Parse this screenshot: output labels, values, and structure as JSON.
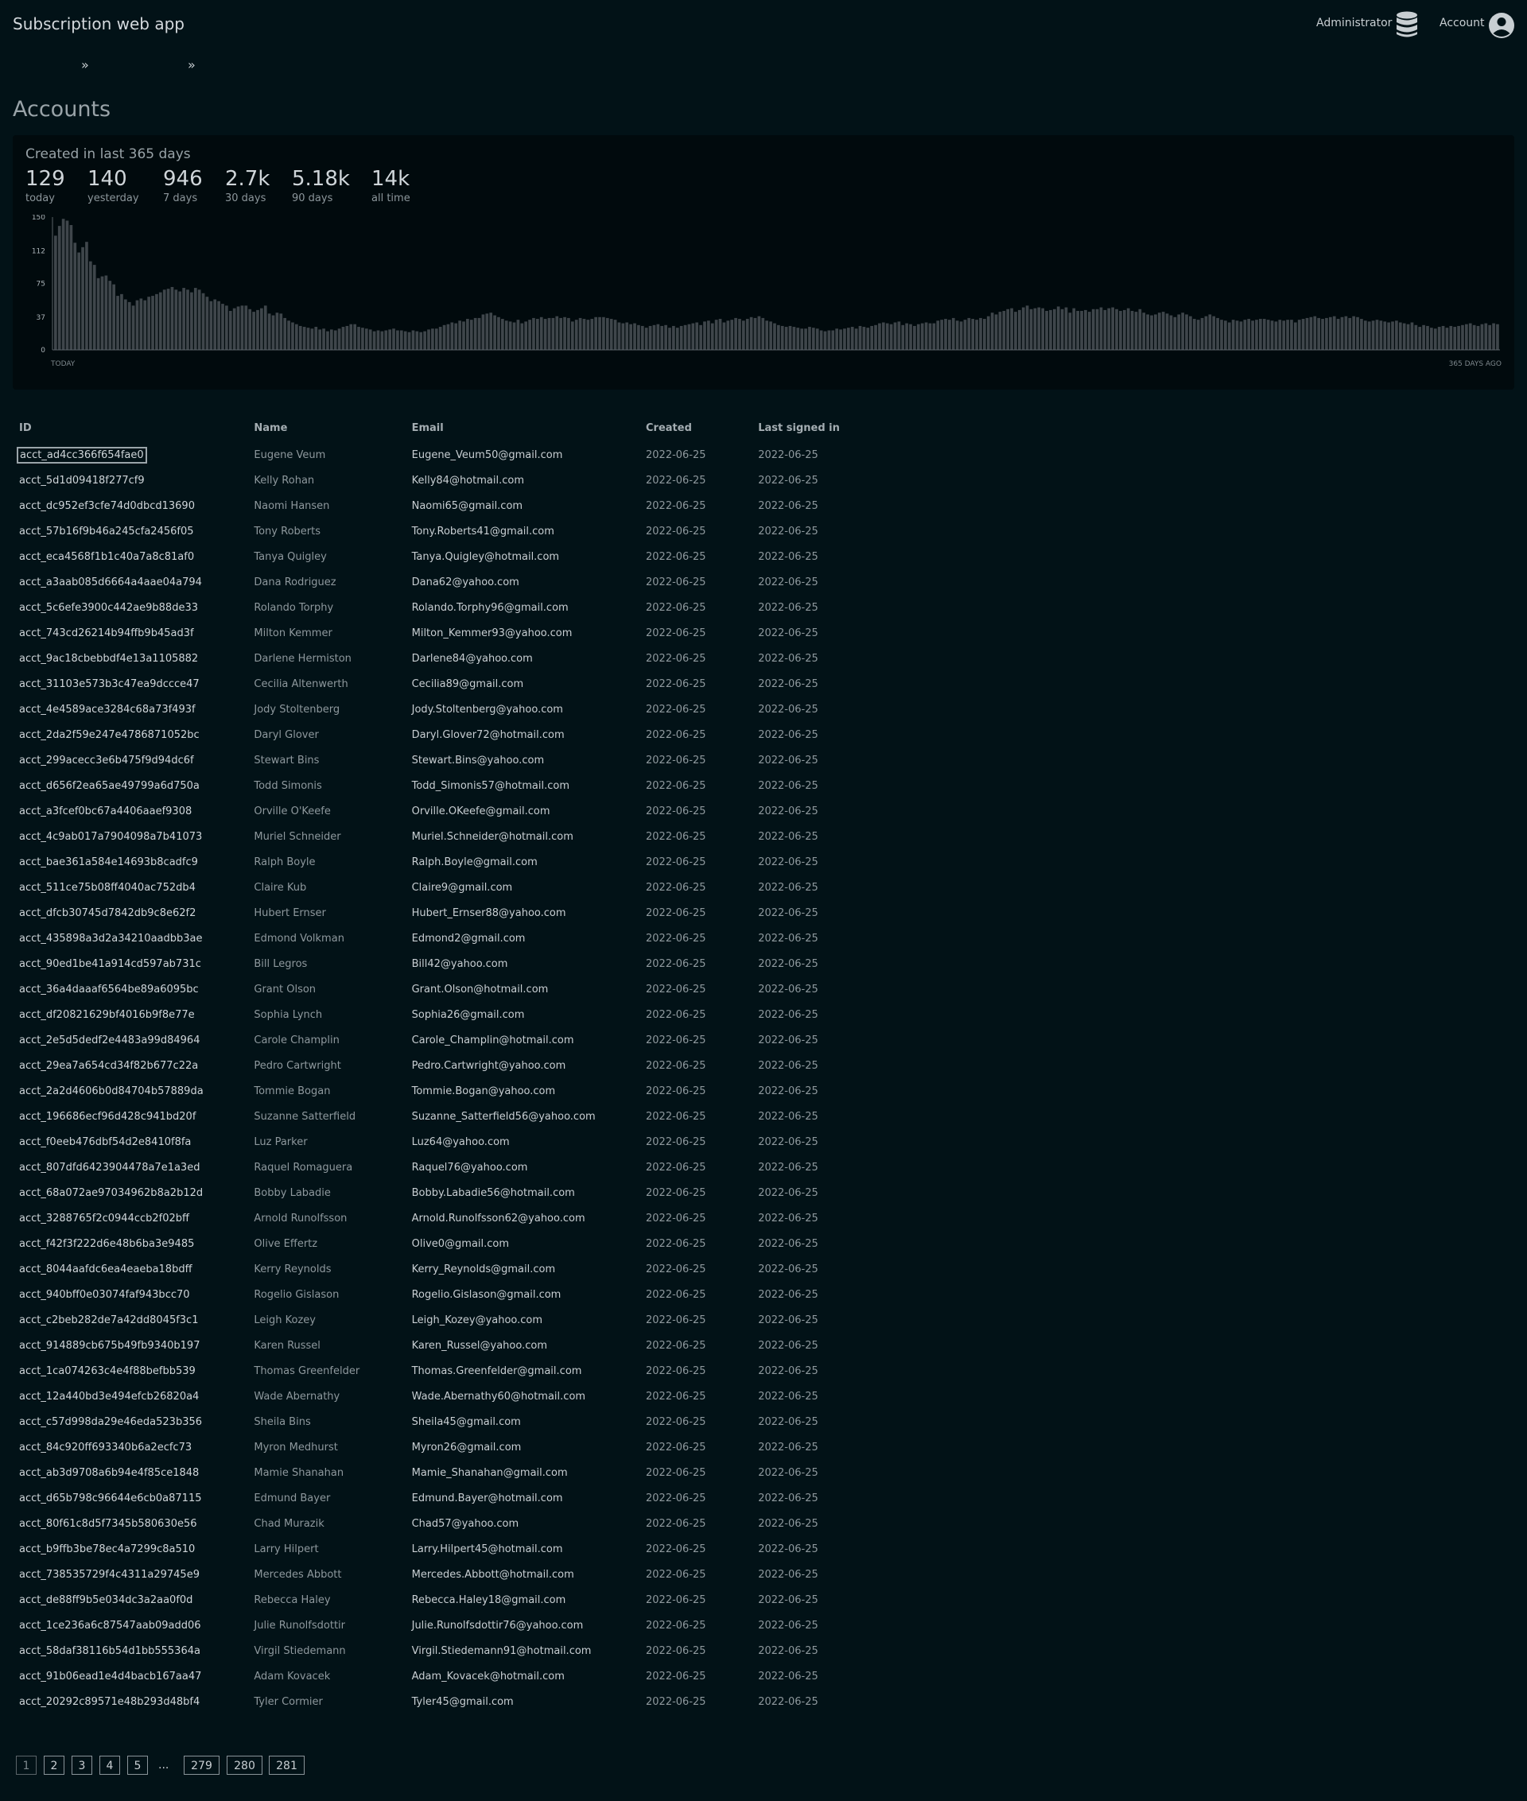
{
  "app": {
    "title": "Subscription web app"
  },
  "header": {
    "admin_label": "Administrator",
    "account_label": "Account",
    "admin_icon": "database-icon",
    "account_icon": "user-circle-icon"
  },
  "breadcrumb": {
    "separators": [
      "»",
      "»"
    ]
  },
  "page": {
    "title": "Accounts"
  },
  "stats": {
    "title": "Created in last 365 days",
    "items": [
      {
        "value": "129",
        "label": "today"
      },
      {
        "value": "140",
        "label": "yesterday"
      },
      {
        "value": "946",
        "label": "7 days"
      },
      {
        "value": "2.7k",
        "label": "30 days"
      },
      {
        "value": "5.18k",
        "label": "90 days"
      },
      {
        "value": "14k",
        "label": "all time"
      }
    ]
  },
  "chart_data": {
    "type": "bar",
    "yticks": [
      0,
      37,
      75,
      112,
      150
    ],
    "ylim": [
      0,
      150
    ],
    "x_start_label": "TODAY",
    "x_end_label": "365 DAYS AGO",
    "colors": {
      "bar": "#3f464b"
    },
    "values": [
      129,
      140,
      148,
      146,
      141,
      121,
      110,
      116,
      122,
      100,
      96,
      81,
      83,
      84,
      78,
      74,
      61,
      63,
      57,
      54,
      50,
      56,
      58,
      56,
      60,
      61,
      63,
      65,
      68,
      69,
      71,
      68,
      66,
      70,
      68,
      65,
      70,
      68,
      64,
      60,
      55,
      57,
      55,
      52,
      50,
      44,
      47,
      49,
      50,
      50,
      46,
      43,
      45,
      47,
      50,
      41,
      39,
      42,
      41,
      36,
      33,
      31,
      29,
      27,
      26,
      25,
      24,
      26,
      23,
      24,
      21,
      23,
      22,
      24,
      26,
      27,
      29,
      29,
      26,
      25,
      24,
      23,
      21,
      22,
      21,
      22,
      23,
      24,
      22,
      22,
      21,
      20,
      22,
      21,
      20,
      21,
      23,
      24,
      24,
      26,
      28,
      29,
      31,
      30,
      33,
      32,
      35,
      34,
      36,
      36,
      40,
      41,
      42,
      39,
      37,
      35,
      33,
      32,
      31,
      34,
      30,
      32,
      34,
      36,
      35,
      37,
      35,
      36,
      36,
      38,
      36,
      37,
      36,
      32,
      34,
      36,
      35,
      34,
      35,
      37,
      37,
      37,
      36,
      35,
      34,
      31,
      30,
      31,
      29,
      30,
      28,
      27,
      25,
      27,
      28,
      29,
      27,
      28,
      25,
      27,
      25,
      27,
      28,
      29,
      30,
      31,
      28,
      32,
      33,
      30,
      34,
      35,
      31,
      33,
      34,
      36,
      35,
      33,
      35,
      37,
      36,
      38,
      36,
      33,
      32,
      30,
      28,
      27,
      26,
      27,
      26,
      25,
      24,
      24,
      26,
      25,
      24,
      22,
      21,
      22,
      22,
      24,
      23,
      24,
      25,
      26,
      24,
      27,
      26,
      25,
      27,
      28,
      30,
      31,
      30,
      29,
      31,
      32,
      28,
      30,
      29,
      27,
      29,
      30,
      31,
      30,
      30,
      33,
      34,
      35,
      34,
      36,
      33,
      32,
      34,
      36,
      35,
      34,
      36,
      35,
      38,
      42,
      40,
      43,
      44,
      46,
      47,
      43,
      45,
      48,
      50,
      46,
      47,
      48,
      47,
      44,
      45,
      46,
      49,
      46,
      48,
      42,
      47,
      44,
      44,
      45,
      43,
      46,
      46,
      48,
      45,
      47,
      48,
      46,
      44,
      45,
      47,
      44,
      43,
      46,
      42,
      40,
      39,
      40,
      42,
      43,
      41,
      39,
      37,
      40,
      42,
      40,
      38,
      35,
      34,
      36,
      38,
      40,
      38,
      36,
      34,
      33,
      31,
      34,
      33,
      32,
      34,
      35,
      33,
      34,
      35,
      35,
      34,
      33,
      32,
      34,
      33,
      34,
      34,
      31,
      34,
      35,
      36,
      37,
      38,
      36,
      35,
      36,
      37,
      38,
      35,
      37,
      38,
      36,
      38,
      37,
      35,
      33,
      32,
      33,
      34,
      33,
      32,
      31,
      32,
      33,
      31,
      30,
      29,
      31,
      28,
      26,
      28,
      27,
      25,
      24,
      26,
      27,
      25,
      27,
      26,
      27,
      28,
      29,
      30,
      28,
      27,
      29,
      30,
      28,
      30,
      29
    ]
  },
  "table": {
    "columns": [
      "ID",
      "Name",
      "Email",
      "Created",
      "Last signed in"
    ],
    "rows": [
      [
        "acct_ad4cc366f654fae0",
        "Eugene Veum",
        "Eugene_Veum50@gmail.com",
        "2022-06-25",
        "2022-06-25"
      ],
      [
        "acct_5d1d09418f277cf9",
        "Kelly Rohan",
        "Kelly84@hotmail.com",
        "2022-06-25",
        "2022-06-25"
      ],
      [
        "acct_dc952ef3cfe74d0dbcd13690",
        "Naomi Hansen",
        "Naomi65@gmail.com",
        "2022-06-25",
        "2022-06-25"
      ],
      [
        "acct_57b16f9b46a245cfa2456f05",
        "Tony Roberts",
        "Tony.Roberts41@gmail.com",
        "2022-06-25",
        "2022-06-25"
      ],
      [
        "acct_eca4568f1b1c40a7a8c81af0",
        "Tanya Quigley",
        "Tanya.Quigley@hotmail.com",
        "2022-06-25",
        "2022-06-25"
      ],
      [
        "acct_a3aab085d6664a4aae04a794",
        "Dana Rodriguez",
        "Dana62@yahoo.com",
        "2022-06-25",
        "2022-06-25"
      ],
      [
        "acct_5c6efe3900c442ae9b88de33",
        "Rolando Torphy",
        "Rolando.Torphy96@gmail.com",
        "2022-06-25",
        "2022-06-25"
      ],
      [
        "acct_743cd26214b94ffb9b45ad3f",
        "Milton Kemmer",
        "Milton_Kemmer93@yahoo.com",
        "2022-06-25",
        "2022-06-25"
      ],
      [
        "acct_9ac18cbebbdf4e13a1105882",
        "Darlene Hermiston",
        "Darlene84@yahoo.com",
        "2022-06-25",
        "2022-06-25"
      ],
      [
        "acct_31103e573b3c47ea9dccce47",
        "Cecilia Altenwerth",
        "Cecilia89@gmail.com",
        "2022-06-25",
        "2022-06-25"
      ],
      [
        "acct_4e4589ace3284c68a73f493f",
        "Jody Stoltenberg",
        "Jody.Stoltenberg@yahoo.com",
        "2022-06-25",
        "2022-06-25"
      ],
      [
        "acct_2da2f59e247e4786871052bc",
        "Daryl Glover",
        "Daryl.Glover72@hotmail.com",
        "2022-06-25",
        "2022-06-25"
      ],
      [
        "acct_299acecc3e6b475f9d94dc6f",
        "Stewart Bins",
        "Stewart.Bins@yahoo.com",
        "2022-06-25",
        "2022-06-25"
      ],
      [
        "acct_d656f2ea65ae49799a6d750a",
        "Todd Simonis",
        "Todd_Simonis57@hotmail.com",
        "2022-06-25",
        "2022-06-25"
      ],
      [
        "acct_a3fcef0bc67a4406aaef9308",
        "Orville O'Keefe",
        "Orville.OKeefe@gmail.com",
        "2022-06-25",
        "2022-06-25"
      ],
      [
        "acct_4c9ab017a7904098a7b41073",
        "Muriel Schneider",
        "Muriel.Schneider@hotmail.com",
        "2022-06-25",
        "2022-06-25"
      ],
      [
        "acct_bae361a584e14693b8cadfc9",
        "Ralph Boyle",
        "Ralph.Boyle@gmail.com",
        "2022-06-25",
        "2022-06-25"
      ],
      [
        "acct_511ce75b08ff4040ac752db4",
        "Claire Kub",
        "Claire9@gmail.com",
        "2022-06-25",
        "2022-06-25"
      ],
      [
        "acct_dfcb30745d7842db9c8e62f2",
        "Hubert Ernser",
        "Hubert_Ernser88@yahoo.com",
        "2022-06-25",
        "2022-06-25"
      ],
      [
        "acct_435898a3d2a34210aadbb3ae",
        "Edmond Volkman",
        "Edmond2@gmail.com",
        "2022-06-25",
        "2022-06-25"
      ],
      [
        "acct_90ed1be41a914cd597ab731c",
        "Bill Legros",
        "Bill42@yahoo.com",
        "2022-06-25",
        "2022-06-25"
      ],
      [
        "acct_36a4daaaf6564be89a6095bc",
        "Grant Olson",
        "Grant.Olson@hotmail.com",
        "2022-06-25",
        "2022-06-25"
      ],
      [
        "acct_df20821629bf4016b9f8e77e",
        "Sophia Lynch",
        "Sophia26@gmail.com",
        "2022-06-25",
        "2022-06-25"
      ],
      [
        "acct_2e5d5dedf2e4483a99d84964",
        "Carole Champlin",
        "Carole_Champlin@hotmail.com",
        "2022-06-25",
        "2022-06-25"
      ],
      [
        "acct_29ea7a654cd34f82b677c22a",
        "Pedro Cartwright",
        "Pedro.Cartwright@yahoo.com",
        "2022-06-25",
        "2022-06-25"
      ],
      [
        "acct_2a2d4606b0d84704b57889da",
        "Tommie Bogan",
        "Tommie.Bogan@yahoo.com",
        "2022-06-25",
        "2022-06-25"
      ],
      [
        "acct_196686ecf96d428c941bd20f",
        "Suzanne Satterfield",
        "Suzanne_Satterfield56@yahoo.com",
        "2022-06-25",
        "2022-06-25"
      ],
      [
        "acct_f0eeb476dbf54d2e8410f8fa",
        "Luz Parker",
        "Luz64@yahoo.com",
        "2022-06-25",
        "2022-06-25"
      ],
      [
        "acct_807dfd6423904478a7e1a3ed",
        "Raquel Romaguera",
        "Raquel76@yahoo.com",
        "2022-06-25",
        "2022-06-25"
      ],
      [
        "acct_68a072ae97034962b8a2b12d",
        "Bobby Labadie",
        "Bobby.Labadie56@hotmail.com",
        "2022-06-25",
        "2022-06-25"
      ],
      [
        "acct_3288765f2c0944ccb2f02bff",
        "Arnold Runolfsson",
        "Arnold.Runolfsson62@yahoo.com",
        "2022-06-25",
        "2022-06-25"
      ],
      [
        "acct_f42f3f222d6e48b6ba3e9485",
        "Olive Effertz",
        "Olive0@gmail.com",
        "2022-06-25",
        "2022-06-25"
      ],
      [
        "acct_8044aafdc6ea4eaeba18bdff",
        "Kerry Reynolds",
        "Kerry_Reynolds@gmail.com",
        "2022-06-25",
        "2022-06-25"
      ],
      [
        "acct_940bff0e03074faf943bcc70",
        "Rogelio Gislason",
        "Rogelio.Gislason@gmail.com",
        "2022-06-25",
        "2022-06-25"
      ],
      [
        "acct_c2beb282de7a42dd8045f3c1",
        "Leigh Kozey",
        "Leigh_Kozey@yahoo.com",
        "2022-06-25",
        "2022-06-25"
      ],
      [
        "acct_914889cb675b49fb9340b197",
        "Karen Russel",
        "Karen_Russel@yahoo.com",
        "2022-06-25",
        "2022-06-25"
      ],
      [
        "acct_1ca074263c4e4f88befbb539",
        "Thomas Greenfelder",
        "Thomas.Greenfelder@gmail.com",
        "2022-06-25",
        "2022-06-25"
      ],
      [
        "acct_12a440bd3e494efcb26820a4",
        "Wade Abernathy",
        "Wade.Abernathy60@hotmail.com",
        "2022-06-25",
        "2022-06-25"
      ],
      [
        "acct_c57d998da29e46eda523b356",
        "Sheila Bins",
        "Sheila45@gmail.com",
        "2022-06-25",
        "2022-06-25"
      ],
      [
        "acct_84c920ff693340b6a2ecfc73",
        "Myron Medhurst",
        "Myron26@gmail.com",
        "2022-06-25",
        "2022-06-25"
      ],
      [
        "acct_ab3d9708a6b94e4f85ce1848",
        "Mamie Shanahan",
        "Mamie_Shanahan@gmail.com",
        "2022-06-25",
        "2022-06-25"
      ],
      [
        "acct_d65b798c96644e6cb0a87115",
        "Edmund Bayer",
        "Edmund.Bayer@hotmail.com",
        "2022-06-25",
        "2022-06-25"
      ],
      [
        "acct_80f61c8d5f7345b580630e56",
        "Chad Murazik",
        "Chad57@yahoo.com",
        "2022-06-25",
        "2022-06-25"
      ],
      [
        "acct_b9ffb3be78ec4a7299c8a510",
        "Larry Hilpert",
        "Larry.Hilpert45@hotmail.com",
        "2022-06-25",
        "2022-06-25"
      ],
      [
        "acct_738535729f4c4311a29745e9",
        "Mercedes Abbott",
        "Mercedes.Abbott@hotmail.com",
        "2022-06-25",
        "2022-06-25"
      ],
      [
        "acct_de88ff9b5e034dc3a2aa0f0d",
        "Rebecca Haley",
        "Rebecca.Haley18@gmail.com",
        "2022-06-25",
        "2022-06-25"
      ],
      [
        "acct_1ce236a6c87547aab09add06",
        "Julie Runolfsdottir",
        "Julie.Runolfsdottir76@yahoo.com",
        "2022-06-25",
        "2022-06-25"
      ],
      [
        "acct_58daf38116b54d1bb555364a",
        "Virgil Stiedemann",
        "Virgil.Stiedemann91@hotmail.com",
        "2022-06-25",
        "2022-06-25"
      ],
      [
        "acct_91b06ead1e4d4bacb167aa47",
        "Adam Kovacek",
        "Adam_Kovacek@hotmail.com",
        "2022-06-25",
        "2022-06-25"
      ],
      [
        "acct_20292c89571e48b293d48bf4",
        "Tyler Cormier",
        "Tyler45@gmail.com",
        "2022-06-25",
        "2022-06-25"
      ]
    ]
  },
  "pagination": {
    "current": "1",
    "pages": [
      "1",
      "2",
      "3",
      "4",
      "5"
    ],
    "ellipsis": "...",
    "last_pages": [
      "279",
      "280",
      "281"
    ]
  }
}
